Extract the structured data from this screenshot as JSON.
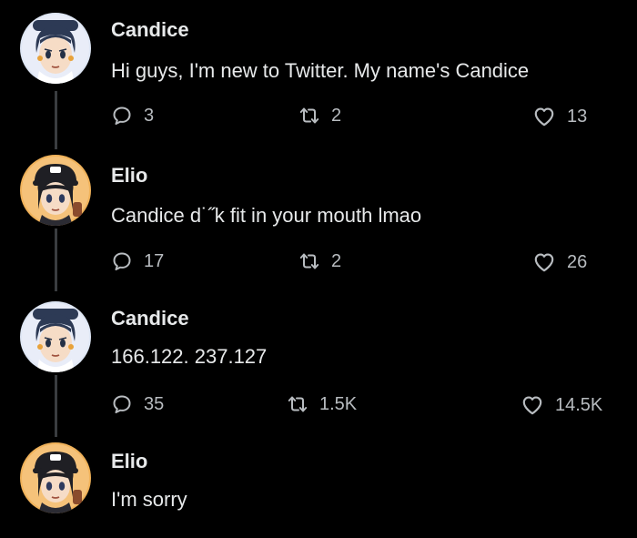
{
  "tweets": [
    {
      "author": "Candice",
      "handle": "",
      "text": "Hi guys, I'm new to Twitter. My name's Candice",
      "avatar_icon": "candice-avatar-icon",
      "replies": "3",
      "retweets": "2",
      "likes": "13"
    },
    {
      "author": "Elio",
      "handle": "",
      "text": "Candice d˙˝k fit in your mouth lmao",
      "avatar_icon": "elio-avatar-icon",
      "replies": "17",
      "retweets": "2",
      "likes": "26"
    },
    {
      "author": "Candice",
      "handle": "",
      "text": "166.122. 237.127",
      "avatar_icon": "candice-avatar-icon",
      "replies": "35",
      "retweets": "1.5K",
      "likes": "14.5K"
    },
    {
      "author": "Elio",
      "handle": "",
      "text": "I'm sorry",
      "avatar_icon": "elio-avatar-icon"
    }
  ],
  "colors": {
    "background": "#000000",
    "text": "#e7e9ea",
    "secondary": "#b8bcc0",
    "thread_line": "#3a3d40"
  }
}
